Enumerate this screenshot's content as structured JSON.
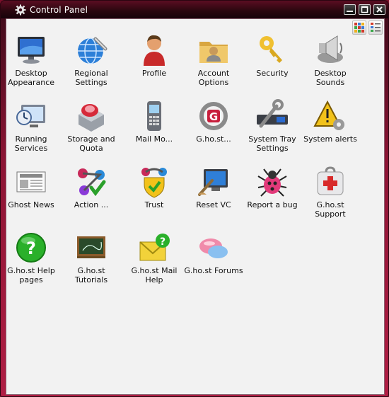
{
  "window": {
    "title": "Control Panel"
  },
  "titlebar_buttons": [
    "minimize-icon",
    "maximize-icon",
    "close-icon"
  ],
  "view_buttons": [
    "icon-view-icon",
    "details-view-icon"
  ],
  "items": [
    {
      "label": "Desktop Appearance",
      "icon": "monitor-icon"
    },
    {
      "label": "Regional Settings",
      "icon": "globe-icon"
    },
    {
      "label": "Profile",
      "icon": "user-icon"
    },
    {
      "label": "Account Options",
      "icon": "account-folder-icon"
    },
    {
      "label": "Security",
      "icon": "key-icon"
    },
    {
      "label": "Desktop Sounds",
      "icon": "speaker-icon"
    },
    {
      "label": "Running Services",
      "icon": "services-monitor-icon"
    },
    {
      "label": "Storage and Quota",
      "icon": "hard-drive-icon"
    },
    {
      "label": "Mail Mo...",
      "icon": "mobile-phone-icon"
    },
    {
      "label": "G.ho.st...",
      "icon": "ghost-tools-icon"
    },
    {
      "label": "System Tray Settings",
      "icon": "tray-wrench-icon"
    },
    {
      "label": "System alerts",
      "icon": "warning-gear-icon"
    },
    {
      "label": "Ghost News",
      "icon": "newspaper-icon"
    },
    {
      "label": "Action ...",
      "icon": "action-check-icon"
    },
    {
      "label": "Trust",
      "icon": "shield-check-icon"
    },
    {
      "label": "Reset VC",
      "icon": "reset-monitor-icon"
    },
    {
      "label": "Report a bug",
      "icon": "bug-icon"
    },
    {
      "label": "G.ho.st Support",
      "icon": "first-aid-icon"
    },
    {
      "label": "G.ho.st Help pages",
      "icon": "help-icon"
    },
    {
      "label": "G.ho.st Tutorials",
      "icon": "chalkboard-icon"
    },
    {
      "label": "G.ho.st Mail Help",
      "icon": "mail-help-icon"
    },
    {
      "label": "G.ho.st Forums",
      "icon": "chat-bubbles-icon"
    }
  ]
}
